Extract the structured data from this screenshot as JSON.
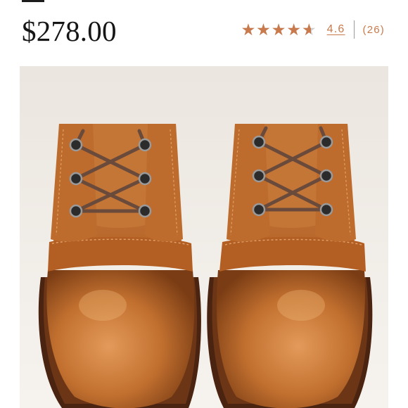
{
  "product": {
    "price": "$278.00"
  },
  "rating": {
    "stars_glyphs": "★★★★★",
    "value": 4.6,
    "max": 5,
    "score_label": "4.6",
    "count_label": "(26)"
  },
  "image": {
    "alt": "Pair of cognac leather lace-up boots"
  },
  "colors": {
    "accent": "#c87a4c",
    "star_empty": "#cfcfcf",
    "price_text": "#161616",
    "image_bg": "#f1ede8",
    "leather": "#b8662a"
  }
}
